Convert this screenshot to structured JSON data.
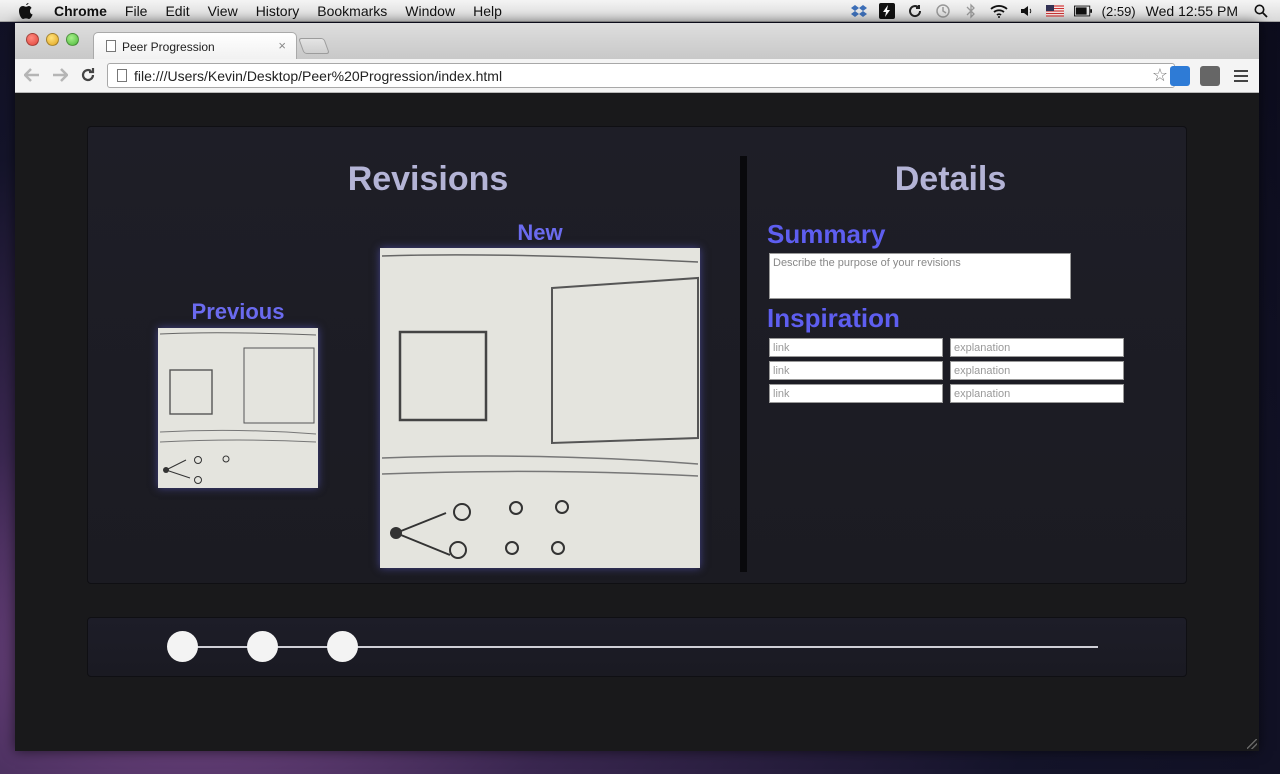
{
  "menubar": {
    "app_name": "Chrome",
    "items": [
      "File",
      "Edit",
      "View",
      "History",
      "Bookmarks",
      "Window",
      "Help"
    ],
    "battery_text": "(2:59)",
    "clock": "Wed 12:55 PM"
  },
  "browser": {
    "tab_title": "Peer Progression",
    "tab_close": "×",
    "url": "file:///Users/Kevin/Desktop/Peer%20Progression/index.html",
    "star_icon": "star-icon"
  },
  "page": {
    "revisions_title": "Revisions",
    "details_title": "Details",
    "previous_label": "Previous",
    "new_label": "New",
    "summary_label": "Summary",
    "summary_placeholder": "Describe the purpose of your revisions",
    "inspiration_label": "Inspiration",
    "inspiration_rows": [
      {
        "link_placeholder": "link",
        "explanation_placeholder": "explanation"
      },
      {
        "link_placeholder": "link",
        "explanation_placeholder": "explanation"
      },
      {
        "link_placeholder": "link",
        "explanation_placeholder": "explanation"
      }
    ],
    "timeline_nodes": 3
  },
  "colors": {
    "title": "#b4b4d6",
    "accent": "#5e5ef0",
    "background": "#19191b"
  }
}
